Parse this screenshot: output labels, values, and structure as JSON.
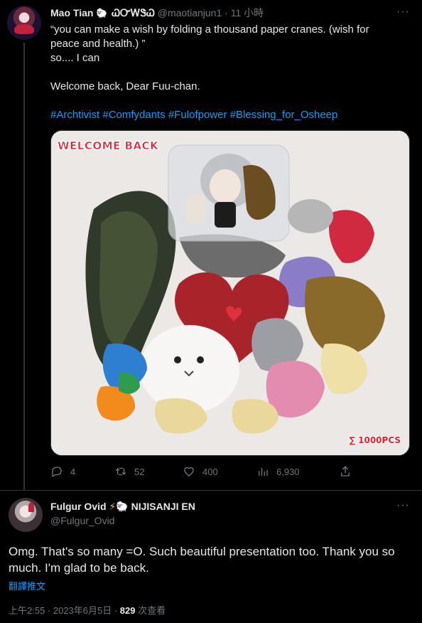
{
  "original_tweet": {
    "display_name": "Mao Tian",
    "name_suffix": "ꙨꙨ",
    "handle": "@maotianjun1",
    "time": "11 小時",
    "lines": [
      "“you can make a wish by folding a thousand paper cranes. (wish for",
      "peace and health.) ”",
      "so.... I can",
      "",
      "Welcome back, Dear Fuu-chan.",
      "",
      "#Archtivist #Comfydants #Fulofpower #Blessing_for_Osheep"
    ],
    "image_text": {
      "banner": "WELCOME BACK",
      "count": "∑ 1000PCS"
    },
    "stats": {
      "replies": "4",
      "retweets": "52",
      "likes": "400",
      "views": "6,930"
    }
  },
  "reply_tweet": {
    "display_name": "Fulgur Ovid",
    "badge_text": "NIJISANJI EN",
    "handle": "@Fulgur_Ovid",
    "text": "Omg. That's so many =O. Such beautiful presentation too. Thank you so much. I'm glad to be back.",
    "translate_label": "翻譯推文",
    "timestamp": "上午2:55 · 2023年6月5日 · ",
    "views_count": "829",
    "views_label": " 次查看"
  },
  "icons": {
    "reply": "reply-icon",
    "retweet": "retweet-icon",
    "like": "heart-icon",
    "views": "views-icon",
    "share": "share-icon",
    "more": "more-icon"
  },
  "colors": {
    "background": "#000000",
    "text": "#e7e9ea",
    "muted": "#71767b",
    "link": "#1d9bf0",
    "banner_red": "#e21d2e"
  }
}
